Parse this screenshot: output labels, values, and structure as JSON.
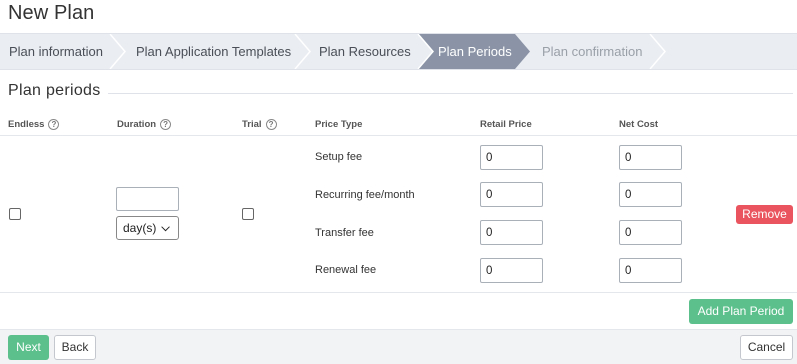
{
  "page": {
    "title": "New Plan"
  },
  "wizard": {
    "steps": [
      {
        "label": "Plan information",
        "state": "done"
      },
      {
        "label": "Plan Application Templates",
        "state": "done"
      },
      {
        "label": "Plan Resources",
        "state": "done"
      },
      {
        "label": "Plan Periods",
        "state": "active"
      },
      {
        "label": "Plan confirmation",
        "state": "future"
      }
    ],
    "colors": {
      "bar": "#eaedf2",
      "active": "#8a94a6",
      "separator": "#ffffff"
    }
  },
  "section": {
    "title": "Plan periods"
  },
  "table": {
    "headers": {
      "endless": "Endless",
      "duration": "Duration",
      "trial": "Trial",
      "price_type": "Price Type",
      "retail_price": "Retail Price",
      "net_cost": "Net Cost"
    },
    "help_icon": "question-circle-icon",
    "row": {
      "endless_checked": false,
      "trial_checked": false,
      "duration_value": "",
      "duration_unit": "day(s)",
      "prices": [
        {
          "type": "Setup fee",
          "retail": "0",
          "net": "0"
        },
        {
          "type": "Recurring fee/month",
          "retail": "0",
          "net": "0"
        },
        {
          "type": "Transfer fee",
          "retail": "0",
          "net": "0"
        },
        {
          "type": "Renewal fee",
          "retail": "0",
          "net": "0"
        }
      ]
    }
  },
  "buttons": {
    "remove": "Remove",
    "add_period": "Add Plan Period",
    "next": "Next",
    "back": "Back",
    "cancel": "Cancel"
  },
  "colors": {
    "success": "#5cc08c",
    "danger": "#e9545e"
  }
}
